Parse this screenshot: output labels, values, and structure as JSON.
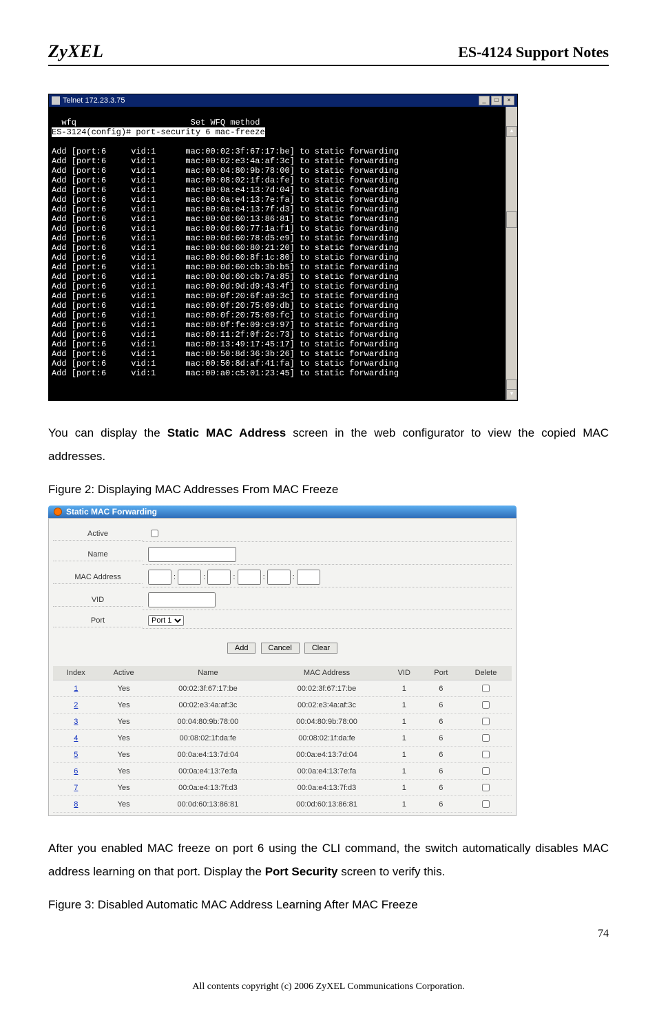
{
  "header": {
    "logo": "ZyXEL",
    "title": "ES-4124 Support Notes"
  },
  "telnet": {
    "title": "Telnet 172.23.3.75",
    "line_prefix": "  wfq                       Set WFQ method",
    "prompt": "ES-3124(config)# port-security 6 mac-freeze",
    "rows": [
      "Add [port:6     vid:1      mac:00:02:3f:67:17:be] to static forwarding",
      "Add [port:6     vid:1      mac:00:02:e3:4a:af:3c] to static forwarding",
      "Add [port:6     vid:1      mac:00:04:80:9b:78:00] to static forwarding",
      "Add [port:6     vid:1      mac:00:08:02:1f:da:fe] to static forwarding",
      "Add [port:6     vid:1      mac:00:0a:e4:13:7d:04] to static forwarding",
      "Add [port:6     vid:1      mac:00:0a:e4:13:7e:fa] to static forwarding",
      "Add [port:6     vid:1      mac:00:0a:e4:13:7f:d3] to static forwarding",
      "Add [port:6     vid:1      mac:00:0d:60:13:86:81] to static forwarding",
      "Add [port:6     vid:1      mac:00:0d:60:77:1a:f1] to static forwarding",
      "Add [port:6     vid:1      mac:00:0d:60:78:d5:e9] to static forwarding",
      "Add [port:6     vid:1      mac:00:0d:60:80:21:20] to static forwarding",
      "Add [port:6     vid:1      mac:00:0d:60:8f:1c:80] to static forwarding",
      "Add [port:6     vid:1      mac:00:0d:60:cb:3b:b5] to static forwarding",
      "Add [port:6     vid:1      mac:00:0d:60:cb:7a:85] to static forwarding",
      "Add [port:6     vid:1      mac:00:0d:9d:d9:43:4f] to static forwarding",
      "Add [port:6     vid:1      mac:00:0f:20:6f:a9:3c] to static forwarding",
      "Add [port:6     vid:1      mac:00:0f:20:75:09:db] to static forwarding",
      "Add [port:6     vid:1      mac:00:0f:20:75:09:fc] to static forwarding",
      "Add [port:6     vid:1      mac:00:0f:fe:09:c9:97] to static forwarding",
      "Add [port:6     vid:1      mac:00:11:2f:0f:2c:73] to static forwarding",
      "Add [port:6     vid:1      mac:00:13:49:17:45:17] to static forwarding",
      "Add [port:6     vid:1      mac:00:50:8d:36:3b:26] to static forwarding",
      "Add [port:6     vid:1      mac:00:50:8d:af:41:fa] to static forwarding",
      "Add [port:6     vid:1      mac:00:a0:c5:01:23:45] to static forwarding"
    ]
  },
  "para1a": "You can display the ",
  "para1b": "Static MAC Address",
  "para1c": " screen in the web configurator to view the copied MAC addresses.",
  "fig2cap": "Figure 2: Displaying MAC Addresses From MAC Freeze",
  "smf": {
    "title": "Static MAC Forwarding",
    "labels": {
      "active": "Active",
      "name": "Name",
      "mac": "MAC Address",
      "vid": "VID",
      "port": "Port",
      "portval": "Port 1"
    },
    "buttons": {
      "add": "Add",
      "cancel": "Cancel",
      "clear": "Clear"
    },
    "cols": [
      "Index",
      "Active",
      "Name",
      "MAC Address",
      "VID",
      "Port",
      "Delete"
    ],
    "rows": [
      {
        "index": "1",
        "active": "Yes",
        "name": "00:02:3f:67:17:be",
        "mac": "00:02:3f:67:17:be",
        "vid": "1",
        "port": "6"
      },
      {
        "index": "2",
        "active": "Yes",
        "name": "00:02:e3:4a:af:3c",
        "mac": "00:02:e3:4a:af:3c",
        "vid": "1",
        "port": "6"
      },
      {
        "index": "3",
        "active": "Yes",
        "name": "00:04:80:9b:78:00",
        "mac": "00:04:80:9b:78:00",
        "vid": "1",
        "port": "6"
      },
      {
        "index": "4",
        "active": "Yes",
        "name": "00:08:02:1f:da:fe",
        "mac": "00:08:02:1f:da:fe",
        "vid": "1",
        "port": "6"
      },
      {
        "index": "5",
        "active": "Yes",
        "name": "00:0a:e4:13:7d:04",
        "mac": "00:0a:e4:13:7d:04",
        "vid": "1",
        "port": "6"
      },
      {
        "index": "6",
        "active": "Yes",
        "name": "00:0a:e4:13:7e:fa",
        "mac": "00:0a:e4:13:7e:fa",
        "vid": "1",
        "port": "6"
      },
      {
        "index": "7",
        "active": "Yes",
        "name": "00:0a:e4:13:7f:d3",
        "mac": "00:0a:e4:13:7f:d3",
        "vid": "1",
        "port": "6"
      },
      {
        "index": "8",
        "active": "Yes",
        "name": "00:0d:60:13:86:81",
        "mac": "00:0d:60:13:86:81",
        "vid": "1",
        "port": "6"
      }
    ]
  },
  "para2a": "After you enabled MAC freeze on port 6 using the CLI command, the switch automatically disables MAC address learning on that port. Display the ",
  "para2b": "Port Security",
  "para2c": " screen to verify this.",
  "fig3cap": "Figure 3: Disabled Automatic MAC Address Learning After MAC Freeze",
  "pagenum": "74",
  "copyright": "All contents copyright (c) 2006 ZyXEL Communications Corporation."
}
